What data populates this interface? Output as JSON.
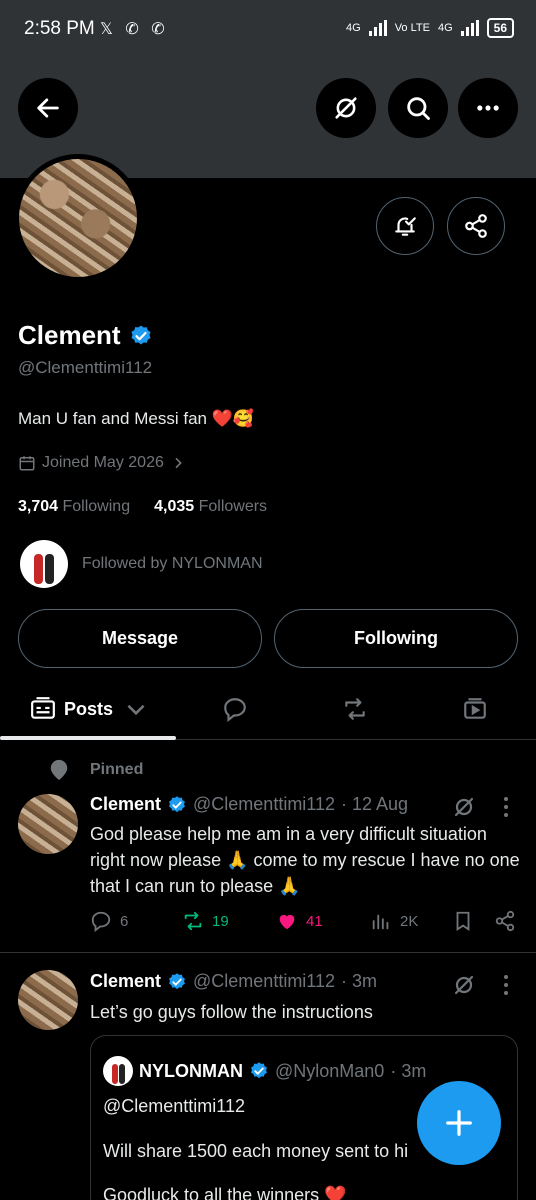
{
  "status_bar": {
    "time": "2:58 PM",
    "network_1": "4G",
    "network_2": "Vo LTE",
    "network_3": "4G",
    "battery": "56"
  },
  "profile": {
    "name": "Clement",
    "handle": "@Clementtimi112",
    "bio": "Man U fan and Messi fan ❤️🥰",
    "joined": "Joined May 2026",
    "following_count": "3,704",
    "following_label": "Following",
    "followers_count": "4,035",
    "followers_label": "Followers",
    "followed_by": "Followed by NYLONMAN"
  },
  "buttons": {
    "message": "Message",
    "following": "Following"
  },
  "tabs": {
    "posts": "Posts"
  },
  "pinned_label": "Pinned",
  "tweets": [
    {
      "name": "Clement",
      "handle": "@Clementtimi112",
      "time": "· 12 Aug",
      "body": "God please help me am in a very difficult situation right now please 🙏 come to my rescue I have no one that I can run to please 🙏",
      "replies": "6",
      "reposts": "19",
      "likes": "41",
      "views": "2K"
    },
    {
      "name": "Clement",
      "handle": "@Clementtimi112",
      "time": "· 3m",
      "body": "Let’s go guys follow the instructions",
      "quote": {
        "name": "NYLONMAN",
        "handle": "@NylonMan0",
        "time": "· 3m",
        "line1": "@Clementtimi112",
        "line2": "Will share 1500 each money sent to hi",
        "line3": "Goodluck to all the winners ❤️"
      }
    }
  ],
  "colors": {
    "accent": "#1d9bf0",
    "repost": "#00ba7c",
    "like": "#f91880",
    "muted": "#71767b"
  }
}
